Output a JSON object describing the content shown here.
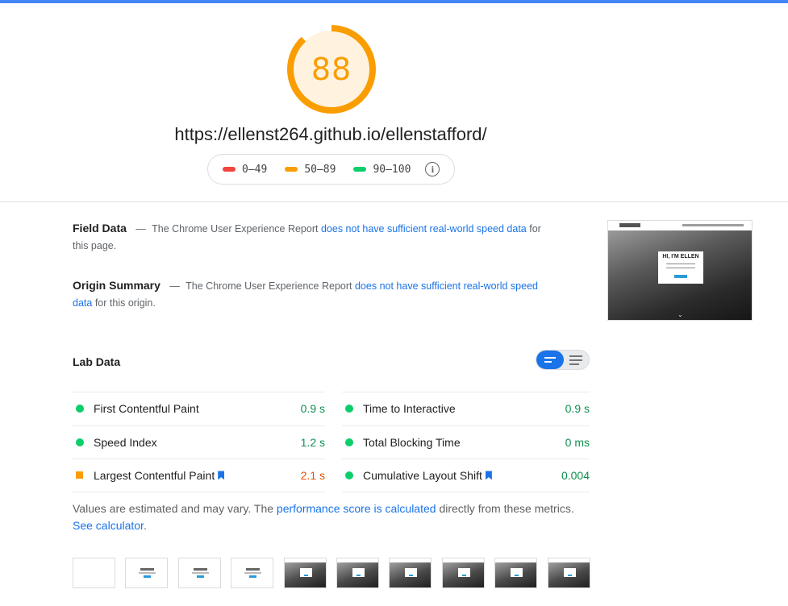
{
  "header": {
    "score": "88",
    "score_fraction": 0.88,
    "url": "https://ellenst264.github.io/ellenstafford/",
    "legend": [
      {
        "range": "0–49",
        "color": "#f4443e"
      },
      {
        "range": "50–89",
        "color": "#fa9d00"
      },
      {
        "range": "90–100",
        "color": "#0cce6b"
      }
    ],
    "info_icon": "info-icon"
  },
  "field_data": {
    "title": "Field Data",
    "dash": "—",
    "text_before": "The Chrome User Experience Report",
    "link": "does not have sufficient real-world speed data",
    "text_after": "for this page."
  },
  "origin_summary": {
    "title": "Origin Summary",
    "dash": "—",
    "text_before": "The Chrome User Experience Report",
    "link": "does not have sufficient real-world speed data",
    "text_after": "for this origin."
  },
  "screenshot": {
    "heading": "HI, I'M ELLEN"
  },
  "lab_data": {
    "title": "Lab Data",
    "left_metrics": [
      {
        "label": "First Contentful Paint",
        "value": "0.9 s",
        "status": "pass",
        "bookmark": false
      },
      {
        "label": "Speed Index",
        "value": "1.2 s",
        "status": "pass",
        "bookmark": false
      },
      {
        "label": "Largest Contentful Paint",
        "value": "2.1 s",
        "status": "average",
        "bookmark": true
      }
    ],
    "right_metrics": [
      {
        "label": "Time to Interactive",
        "value": "0.9 s",
        "status": "pass",
        "bookmark": false
      },
      {
        "label": "Total Blocking Time",
        "value": "0 ms",
        "status": "pass",
        "bookmark": false
      },
      {
        "label": "Cumulative Layout Shift",
        "value": "0.004",
        "status": "pass",
        "bookmark": true
      }
    ]
  },
  "note": {
    "text1": "Values are estimated and may vary. The",
    "link1": "performance score is calculated",
    "text2": "directly from these metrics.",
    "link2": "See calculator",
    "text3": "."
  },
  "filmstrip": [
    "blank",
    "light",
    "light",
    "light",
    "dark",
    "dark",
    "dark",
    "dark",
    "dark",
    "dark"
  ],
  "colors": {
    "accent": "#1a73e8",
    "average": "#fa9d00",
    "pass": "#0cce6b",
    "fail": "#f4443e"
  }
}
